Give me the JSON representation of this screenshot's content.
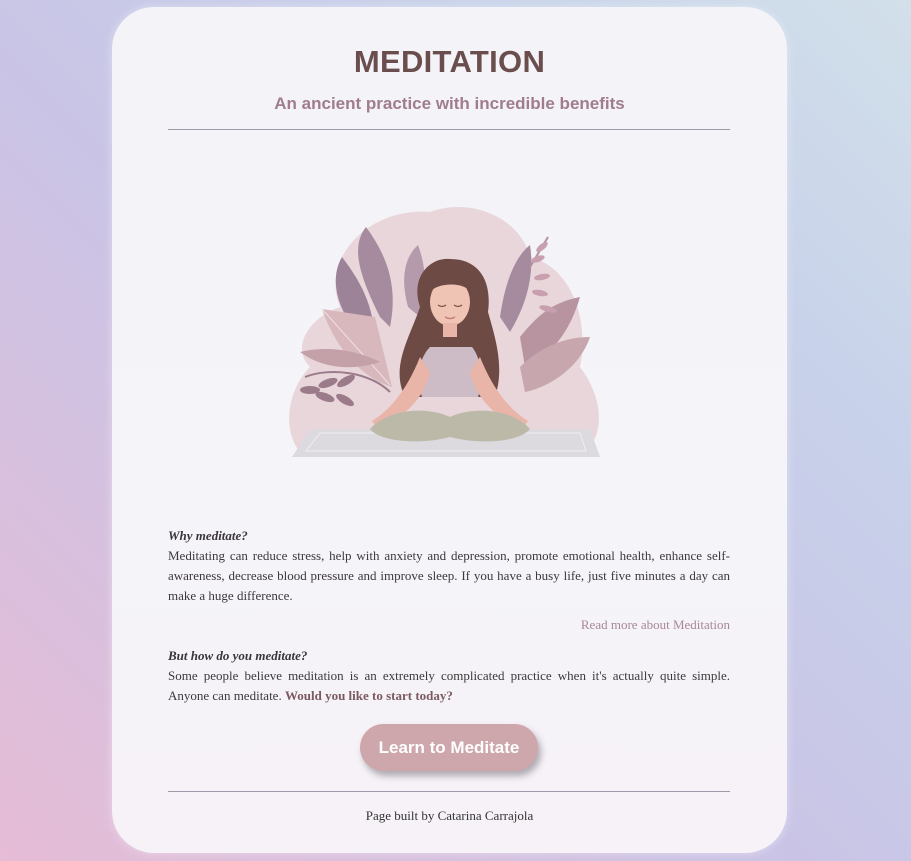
{
  "header": {
    "title": "MEDITATION",
    "subtitle": "An ancient practice with incredible benefits"
  },
  "hero": {
    "image_alt": "Woman meditating illustration"
  },
  "why": {
    "heading": "Why meditate?",
    "text": "Meditating can reduce stress, help with anxiety and depression, promote emotional health, enhance self-awareness, decrease blood pressure and improve sleep. If you have a busy life, just five minutes a day can make a huge difference.",
    "link_label": "Read more about Meditation"
  },
  "how": {
    "heading": "But how do you meditate?",
    "text": "Some people believe meditation is an extremely complicated practice when it's actually quite simple. Anyone can meditate.",
    "cta_text": "Would you like to start today?"
  },
  "cta_button": {
    "label": "Learn to Meditate"
  },
  "footer": {
    "credit": "Page built by Catarina Carrajola"
  },
  "colors": {
    "title": "#6a4e4d",
    "subtitle": "#a07c8e",
    "button": "#cea7ac",
    "link": "#a8879a"
  }
}
